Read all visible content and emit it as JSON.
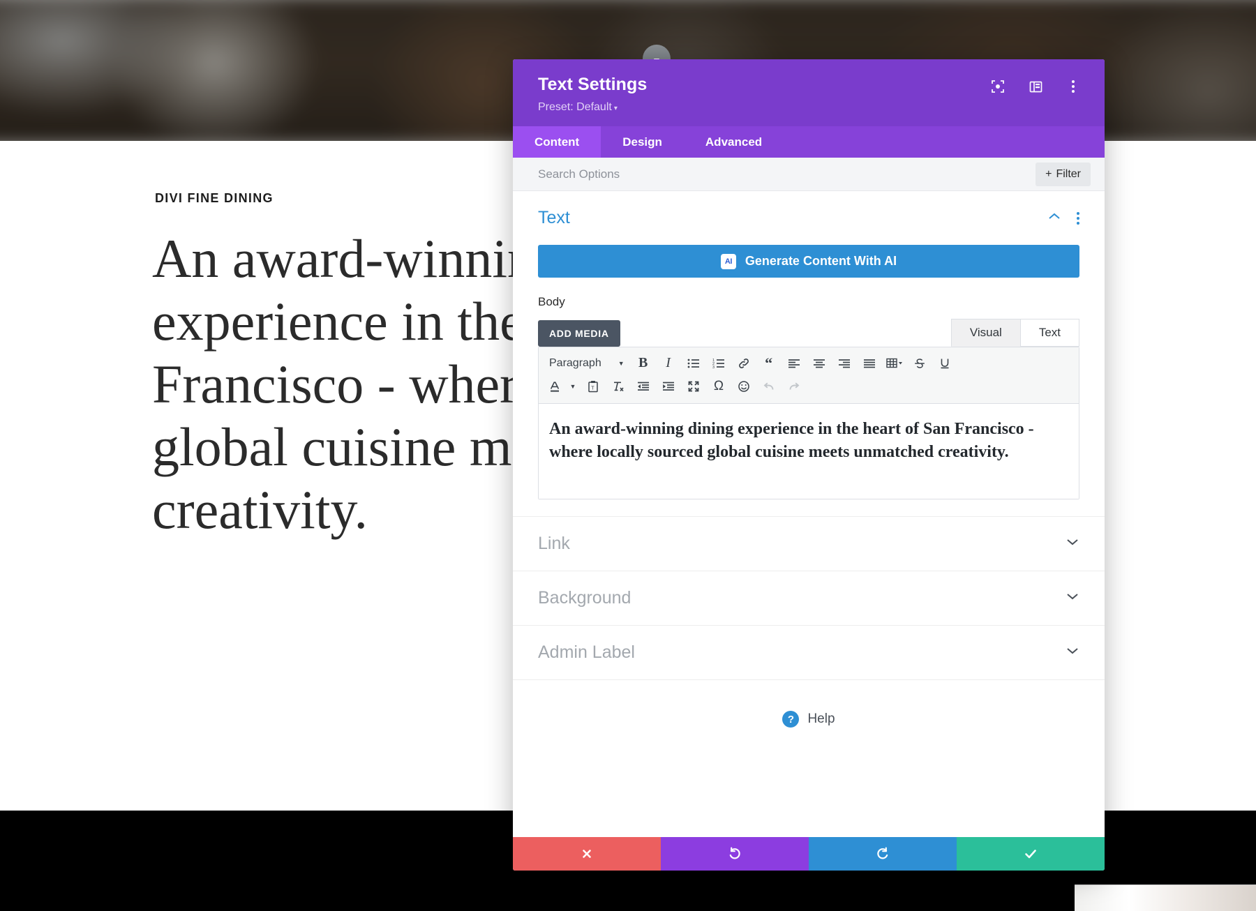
{
  "website": {
    "eyebrow": "DIVI FINE DINING",
    "heading": "An award-winning dining experience in the heart of San Francisco - where locally sourced global cuisine meets unmatched creativity."
  },
  "modal": {
    "title": "Text Settings",
    "preset": "Preset: Default",
    "preset_caret": "▾",
    "header_icons": [
      {
        "name": "focus-target-icon"
      },
      {
        "name": "panel-layout-icon"
      },
      {
        "name": "more-options-icon"
      }
    ],
    "tabs": [
      {
        "label": "Content",
        "active": true
      },
      {
        "label": "Design",
        "active": false
      },
      {
        "label": "Advanced",
        "active": false
      }
    ],
    "search": {
      "placeholder": "Search Options",
      "value": ""
    },
    "filter_button": {
      "label": "Filter",
      "plus": "+"
    },
    "sections": [
      {
        "label": "Text",
        "state": "open"
      },
      {
        "label": "Link",
        "state": "closed"
      },
      {
        "label": "Background",
        "state": "closed"
      },
      {
        "label": "Admin Label",
        "state": "closed"
      }
    ],
    "ai_button": {
      "label": "Generate Content With AI",
      "glyph": "AI"
    },
    "body_field": {
      "label": "Body",
      "add_media": "ADD MEDIA",
      "editor_tabs": [
        {
          "label": "Visual",
          "active": true
        },
        {
          "label": "Text",
          "active": false
        }
      ],
      "format_select": "Paragraph",
      "toolbar_row1": [
        {
          "name": "bold-icon",
          "glyph": "B"
        },
        {
          "name": "italic-icon",
          "glyph": "I"
        },
        {
          "name": "bulleted-list-icon",
          "glyph": "•≡"
        },
        {
          "name": "numbered-list-icon",
          "glyph": "1≡"
        },
        {
          "name": "link-icon",
          "glyph": "🔗"
        },
        {
          "name": "blockquote-icon",
          "glyph": "❝"
        },
        {
          "name": "align-left-icon",
          "glyph": "≡"
        },
        {
          "name": "align-center-icon",
          "glyph": "≡"
        },
        {
          "name": "align-right-icon",
          "glyph": "≡"
        },
        {
          "name": "align-justify-icon",
          "glyph": "≡"
        },
        {
          "name": "table-icon",
          "glyph": "▦"
        },
        {
          "name": "strikethrough-icon",
          "glyph": "S"
        },
        {
          "name": "underline-icon",
          "glyph": "U"
        }
      ],
      "toolbar_row2": [
        {
          "name": "text-color-icon",
          "glyph": "A"
        },
        {
          "name": "paste-as-text-icon",
          "glyph": "📋"
        },
        {
          "name": "clear-formatting-icon",
          "glyph": "Tx"
        },
        {
          "name": "outdent-icon",
          "glyph": "⇤"
        },
        {
          "name": "indent-icon",
          "glyph": "⇥"
        },
        {
          "name": "fullscreen-icon",
          "glyph": "⤢"
        },
        {
          "name": "special-character-icon",
          "glyph": "Ω"
        },
        {
          "name": "emoji-icon",
          "glyph": "☺"
        },
        {
          "name": "undo-icon",
          "glyph": "↶"
        },
        {
          "name": "redo-icon",
          "glyph": "↷"
        }
      ],
      "content": "An award-winning dining experience in the heart of San Francisco - where locally sourced global cuisine meets unmatched creativity."
    },
    "help": {
      "label": "Help",
      "glyph": "?"
    },
    "footer_buttons": [
      {
        "name": "cancel-button",
        "glyph": "✕",
        "color": "#ec5f5f"
      },
      {
        "name": "undo-button",
        "glyph": "↺",
        "color": "#8c3de0"
      },
      {
        "name": "redo-button",
        "glyph": "↻",
        "color": "#2e8fd4"
      },
      {
        "name": "save-button",
        "glyph": "✓",
        "color": "#2bbf9a"
      }
    ]
  },
  "colors": {
    "header_purple": "#7a3ccc",
    "tab_purple": "#8642d9",
    "active_tab_purple": "#9b4ff0",
    "accent_blue": "#2e8fd4",
    "muted_grey": "#a3a8ae"
  }
}
